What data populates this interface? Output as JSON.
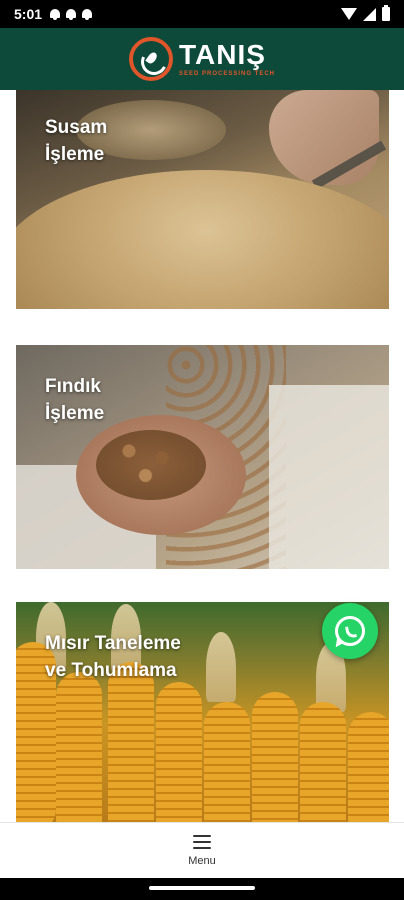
{
  "status_bar": {
    "time": "5:01",
    "notification_icons": [
      "bell-icon",
      "bell-icon",
      "bell-icon"
    ],
    "right_icons": [
      "wifi-icon",
      "signal-icon",
      "battery-icon"
    ]
  },
  "header": {
    "brand_name": "TANIŞ",
    "brand_tagline": "SEED PROCESSING TECH",
    "background_color": "#0d4a3a",
    "accent_color": "#e0552a"
  },
  "cards": [
    {
      "title": "Susam\nİşleme"
    },
    {
      "title": "Fındık\nİşleme"
    },
    {
      "title": "Mısır Taneleme\nve Tohumlama"
    }
  ],
  "whatsapp": {
    "icon": "whatsapp-icon",
    "color": "#25d366"
  },
  "bottom_nav": {
    "icon": "hamburger-menu-icon",
    "label": "Menu"
  }
}
